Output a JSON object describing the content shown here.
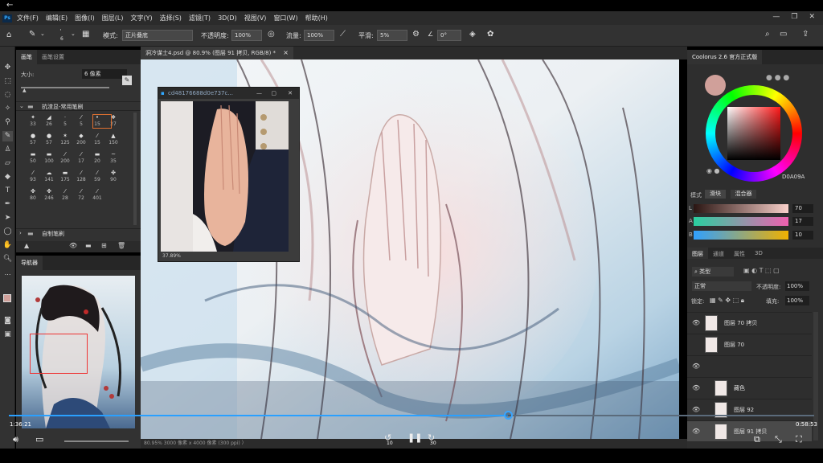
{
  "topbar": {
    "back_icon": "back-arrow-icon"
  },
  "menubar": {
    "app_icon": "Ps",
    "items": [
      "文件(F)",
      "编辑(E)",
      "图像(I)",
      "图层(L)",
      "文字(Y)",
      "选择(S)",
      "滤镜(T)",
      "3D(D)",
      "视图(V)",
      "窗口(W)",
      "帮助(H)"
    ]
  },
  "options": {
    "brush_size": "6",
    "mode_label": "模式:",
    "mode_value": "正片叠底",
    "opacity_label": "不透明度:",
    "opacity_value": "100%",
    "flow_label": "流量:",
    "flow_value": "100%",
    "smooth_label": "平滑:",
    "smooth_value": "5%",
    "angle_value": "0°"
  },
  "brush_panel": {
    "tabs": [
      "画笔",
      "画笔设置"
    ],
    "size_label": "大小:",
    "size_value": "6 像素",
    "group1": "抗渣显-常用笔刷",
    "group2": "自制笔刷",
    "sizes": [
      "33",
      "26",
      "5",
      "5",
      "15",
      "27",
      "57",
      "57",
      "125",
      "200",
      "15",
      "150",
      "50",
      "100",
      "200",
      "17",
      "20",
      "35",
      "93",
      "141",
      "175",
      "128",
      "59",
      "90",
      "80",
      "246",
      "28",
      "72",
      "401"
    ]
  },
  "navigator": {
    "tab": "导航器"
  },
  "document": {
    "tab_title": "洞冷谋士4.psd @ 80.9% (图层 91 拷贝, RGB/8) *",
    "status": "80.95%   3000 像素 x 4000 像素 (300 ppi)   〉"
  },
  "ref_window": {
    "title": "cd48176688d0e737c...",
    "zoom": "37.89%"
  },
  "color_panel": {
    "title": "Coolorus 2.6 官方正式版",
    "hex": "D0A09A",
    "mode_label": "模式",
    "mode_a": "滑块",
    "mode_b": "混合器",
    "sliders": [
      {
        "label": "L",
        "value": "70"
      },
      {
        "label": "A",
        "value": "17"
      },
      {
        "label": "B",
        "value": "10"
      }
    ]
  },
  "layers_panel": {
    "tabs": [
      "图层",
      "通道",
      "属性",
      "3D"
    ],
    "filter_label": "类型",
    "blend_mode": "正常",
    "opacity_label": "不透明度:",
    "opacity_value": "100%",
    "lock_label": "锁定:",
    "fill_label": "填充:",
    "fill_value": "100%",
    "layers": [
      "图层 70 拷贝",
      "图层 70",
      "",
      "藏色",
      "图层 92",
      "图层 91 拷贝"
    ]
  },
  "player": {
    "elapsed": "1:36:21",
    "remaining": "0:58:53",
    "progress": 0.62,
    "rewind_label": "10",
    "forward_label": "30"
  },
  "colors": {
    "accent": "#2aa0ff",
    "panel_bg": "#323232",
    "foreground": "#d0a09a"
  }
}
